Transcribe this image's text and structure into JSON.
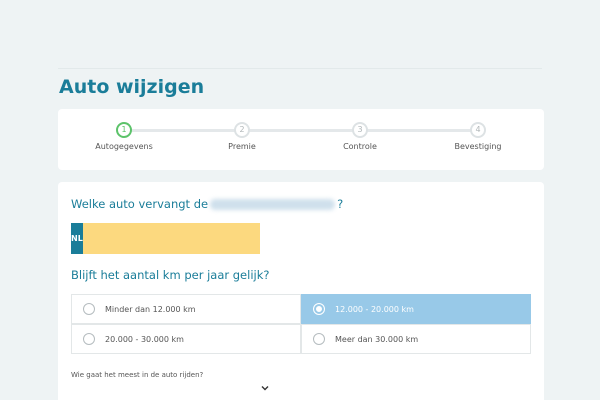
{
  "page": {
    "title": "Auto wijzigen"
  },
  "steps": [
    {
      "number": "1",
      "label": "Autogegevens"
    },
    {
      "number": "2",
      "label": "Premie"
    },
    {
      "number": "3",
      "label": "Controle"
    },
    {
      "number": "4",
      "label": "Bevestiging"
    }
  ],
  "form": {
    "question1_prefix": "Welke auto vervangt de",
    "question1_suffix": "?",
    "plate_country": "NL",
    "plate_value": "",
    "question2": "Blijft het aantal km per jaar gelijk?",
    "km_options": [
      {
        "label": "Minder dan 12.000 km",
        "selected": false
      },
      {
        "label": "12.000 - 20.000 km",
        "selected": true
      },
      {
        "label": "20.000 - 30.000 km",
        "selected": false
      },
      {
        "label": "Meer dan 30.000 km",
        "selected": false
      }
    ],
    "driver_question": "Wie gaat het meest in de auto rijden?"
  },
  "icons": {
    "dropdown": "chevron-down-icon"
  },
  "colors": {
    "accent": "#1a7d99",
    "active_step": "#5cc36a",
    "selected_option": "#98c9e8",
    "plate_yellow": "#fcd97f",
    "background": "#eef3f4"
  }
}
